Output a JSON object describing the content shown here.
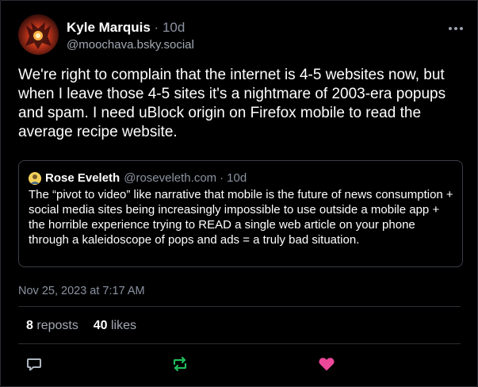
{
  "post": {
    "author_name": "Kyle Marquis",
    "separator": "·",
    "time_ago": "10d",
    "handle": "@moochava.bsky.social",
    "text": "We're right to complain that the internet is 4-5 websites now, but when I leave those 4-5 sites it's a nightmare of 2003-era popups and spam. I need uBlock origin on Firefox mobile to read the average recipe website.",
    "timestamp": "Nov 25, 2023 at 7:17 AM"
  },
  "quote": {
    "author_name": "Rose Eveleth",
    "handle": "@roseveleth.com",
    "separator": "·",
    "time_ago": "10d",
    "text": "The “pivot to video” like narrative that mobile is the future of news consumption + social media sites being increasingly impossible to use outside a mobile app + the horrible experience trying to READ a single web article on your phone through a kaleidoscope of pops and ads = a truly bad situation."
  },
  "stats": {
    "reposts_count": "8",
    "reposts_label": "reposts",
    "likes_count": "40",
    "likes_label": "likes"
  },
  "icons": {
    "reply": "reply-icon",
    "repost": "repost-icon",
    "like": "heart-icon",
    "more": "more-options-icon"
  },
  "colors": {
    "background": "#000000",
    "repost_active": "#20bc5a",
    "like_active": "#ec4899",
    "secondary_text": "#8b93a1"
  }
}
